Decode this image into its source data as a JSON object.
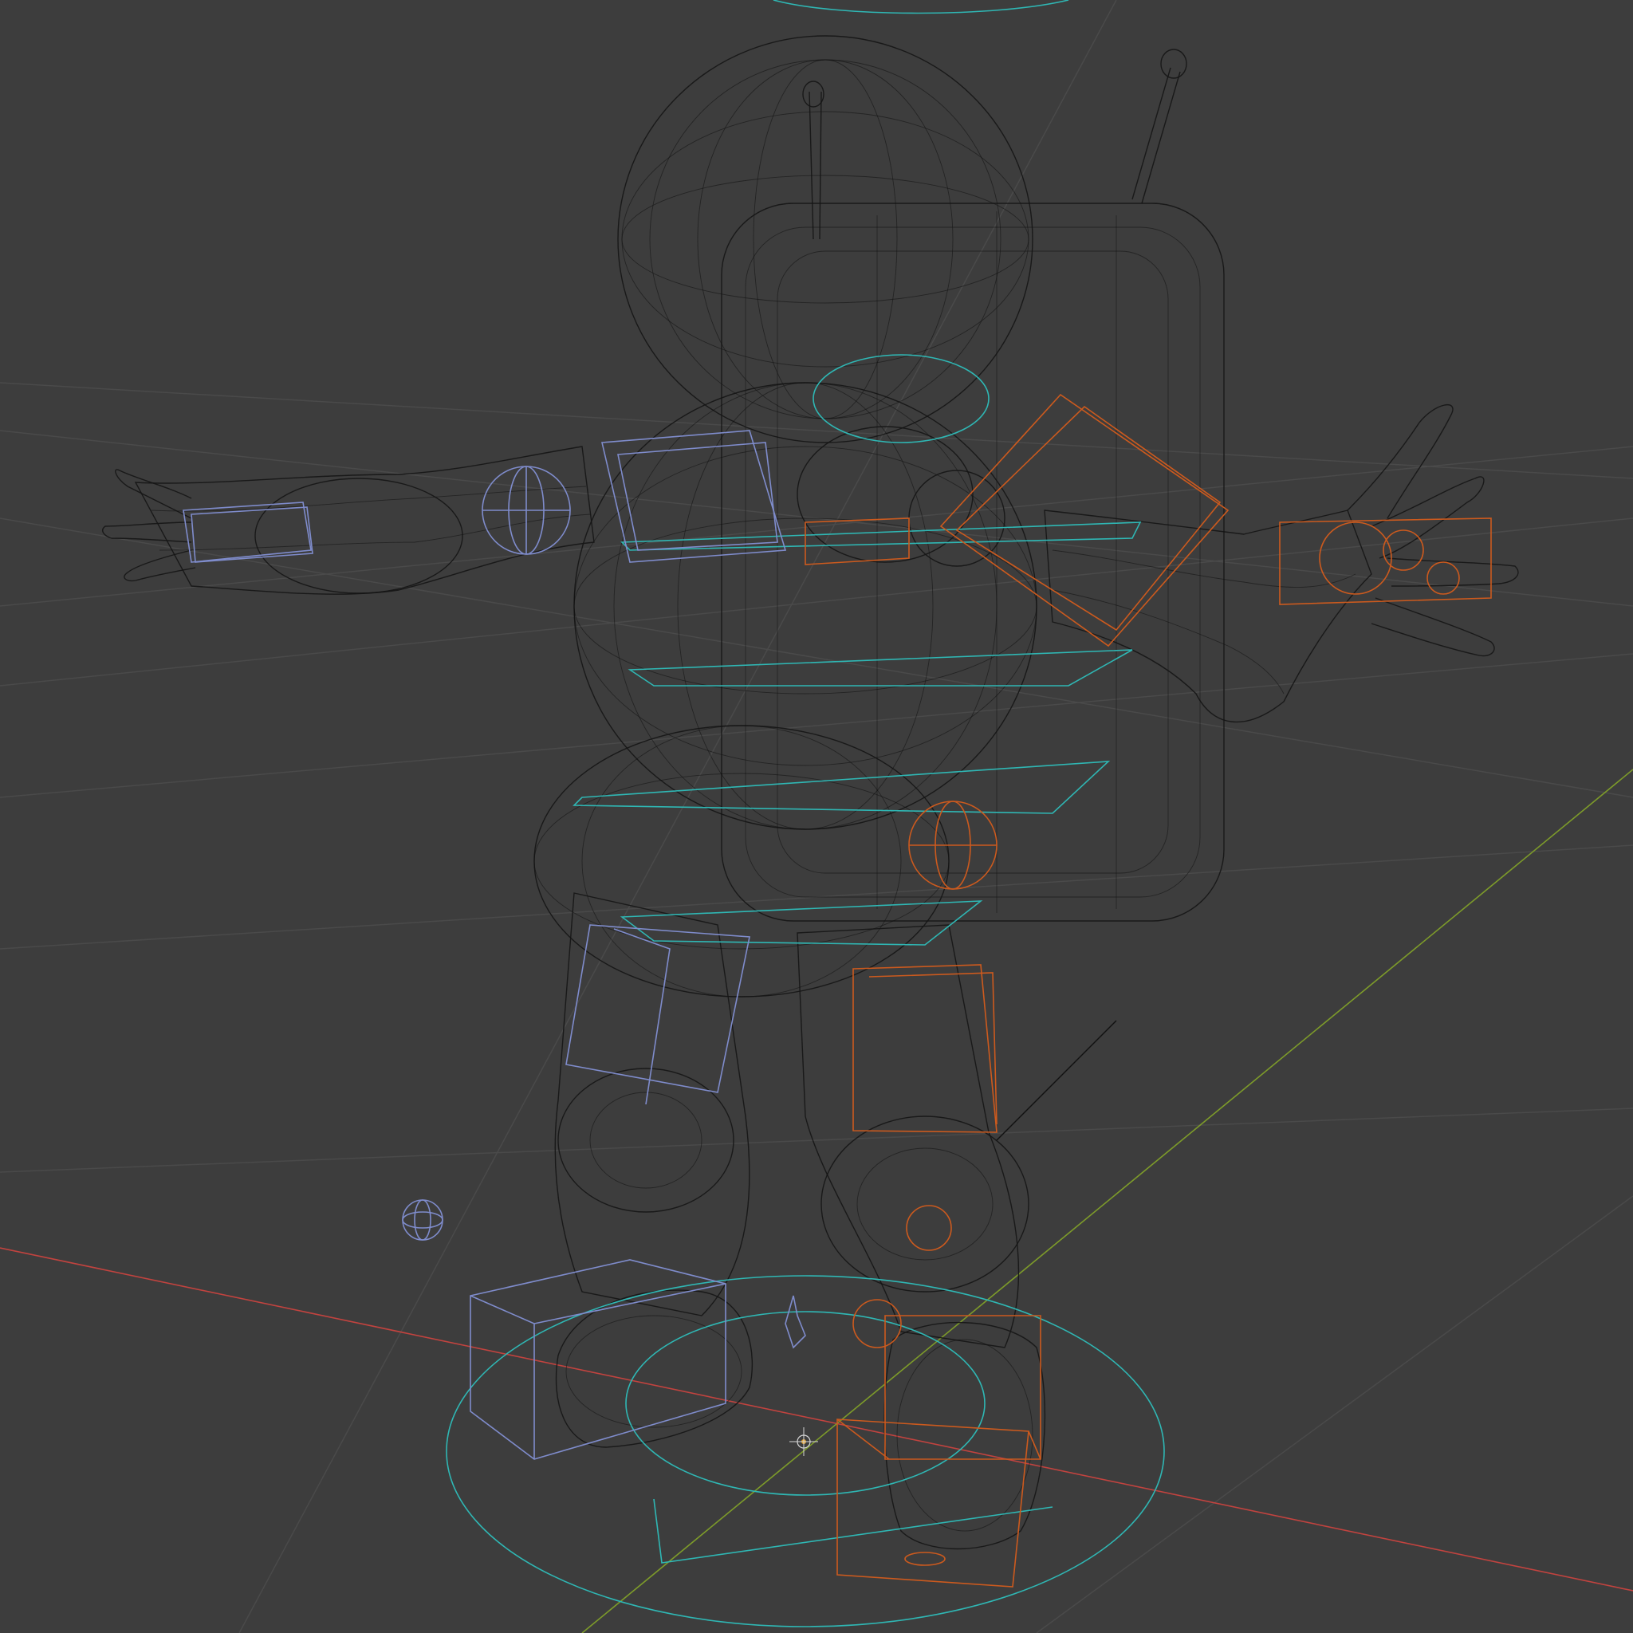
{
  "viewport": {
    "mode": "wireframe",
    "background": "#3d3d3d",
    "grid_color": "#4a4a4a",
    "mesh_color": "#151515",
    "axis_x_color": "#c2433f",
    "axis_y_color": "#7d9b2a",
    "controls": {
      "center_color": "#2fb7b4",
      "left_color": "#7f8ccc",
      "right_color": "#cc5a1e"
    },
    "subject": "astronaut-character-rig"
  }
}
